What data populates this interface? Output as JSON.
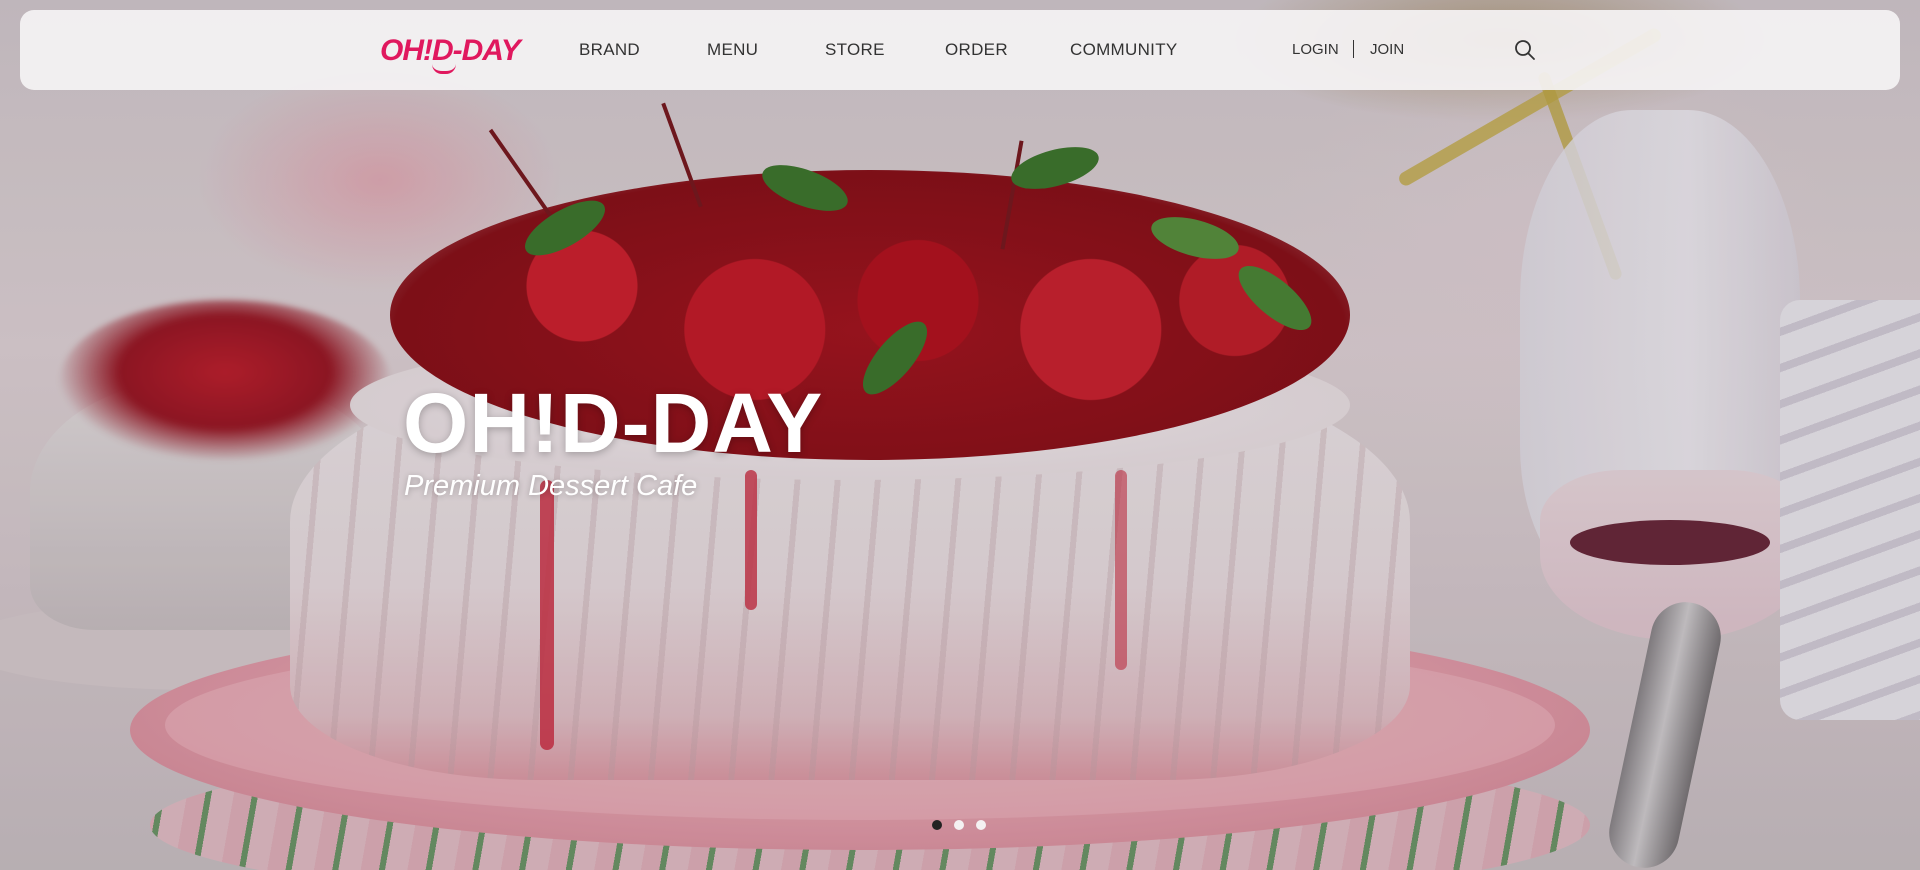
{
  "header": {
    "logo_text": "OH!D-DAY",
    "nav": [
      {
        "label": "BRAND"
      },
      {
        "label": "MENU"
      },
      {
        "label": "STORE"
      },
      {
        "label": "ORDER"
      },
      {
        "label": "COMMUNITY"
      }
    ],
    "login_label": "LOGIN",
    "join_label": "JOIN",
    "search_icon": "search-icon"
  },
  "hero": {
    "title": "OH!D-DAY",
    "subtitle": "Premium Dessert Cafe",
    "slides_total": 3,
    "active_slide": 1
  },
  "colors": {
    "brand": "#e0185e",
    "header_bg": "#f5f3f4",
    "text": "#333333",
    "dot_active": "#222222",
    "dot_inactive": "#f4f1f2"
  }
}
